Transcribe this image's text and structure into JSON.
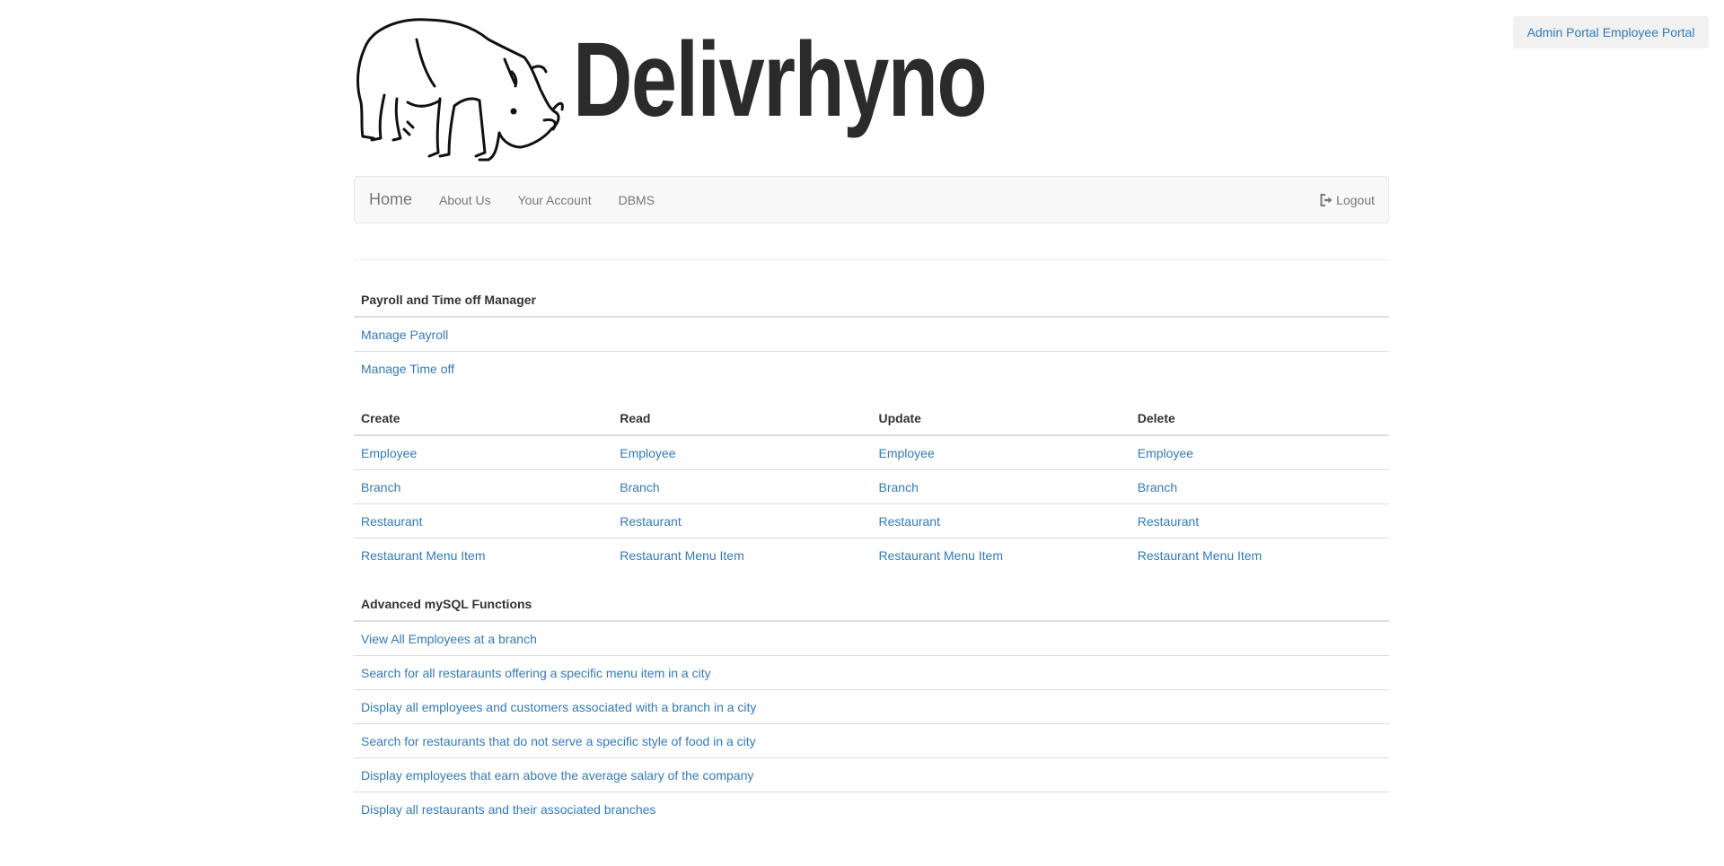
{
  "portal_links": {
    "admin": "Admin Portal",
    "employee": "Employee Portal"
  },
  "brand": {
    "name": "Delivrhyno",
    "logo_icon": "rhino-icon"
  },
  "navbar": {
    "home": "Home",
    "items": [
      "About Us",
      "Your Account",
      "DBMS"
    ],
    "logout": "Logout",
    "logout_icon": "log-out-icon"
  },
  "payroll": {
    "heading": "Payroll and Time off Manager",
    "links": [
      "Manage Payroll",
      "Manage Time off"
    ]
  },
  "crud": {
    "headers": [
      "Create",
      "Read",
      "Update",
      "Delete"
    ],
    "rows": [
      [
        "Employee",
        "Employee",
        "Employee",
        "Employee"
      ],
      [
        "Branch",
        "Branch",
        "Branch",
        "Branch"
      ],
      [
        "Restaurant",
        "Restaurant",
        "Restaurant",
        "Restaurant"
      ],
      [
        "Restaurant Menu Item",
        "Restaurant Menu Item",
        "Restaurant Menu Item",
        "Restaurant Menu Item"
      ]
    ]
  },
  "advanced": {
    "heading": "Advanced mySQL Functions",
    "links": [
      "View All Employees at a branch",
      "Search for all restaraunts offering a specific menu item in a city",
      "Display all employees and customers associated with a branch in a city",
      "Search for restaurants that do not serve a specific style of food in a city",
      "Display employees that earn above the average salary of the company",
      "Display all restaurants and their associated branches"
    ]
  },
  "colors": {
    "link": "#337ab7",
    "navbar_bg": "#f8f8f8",
    "nav_text": "#777777"
  }
}
